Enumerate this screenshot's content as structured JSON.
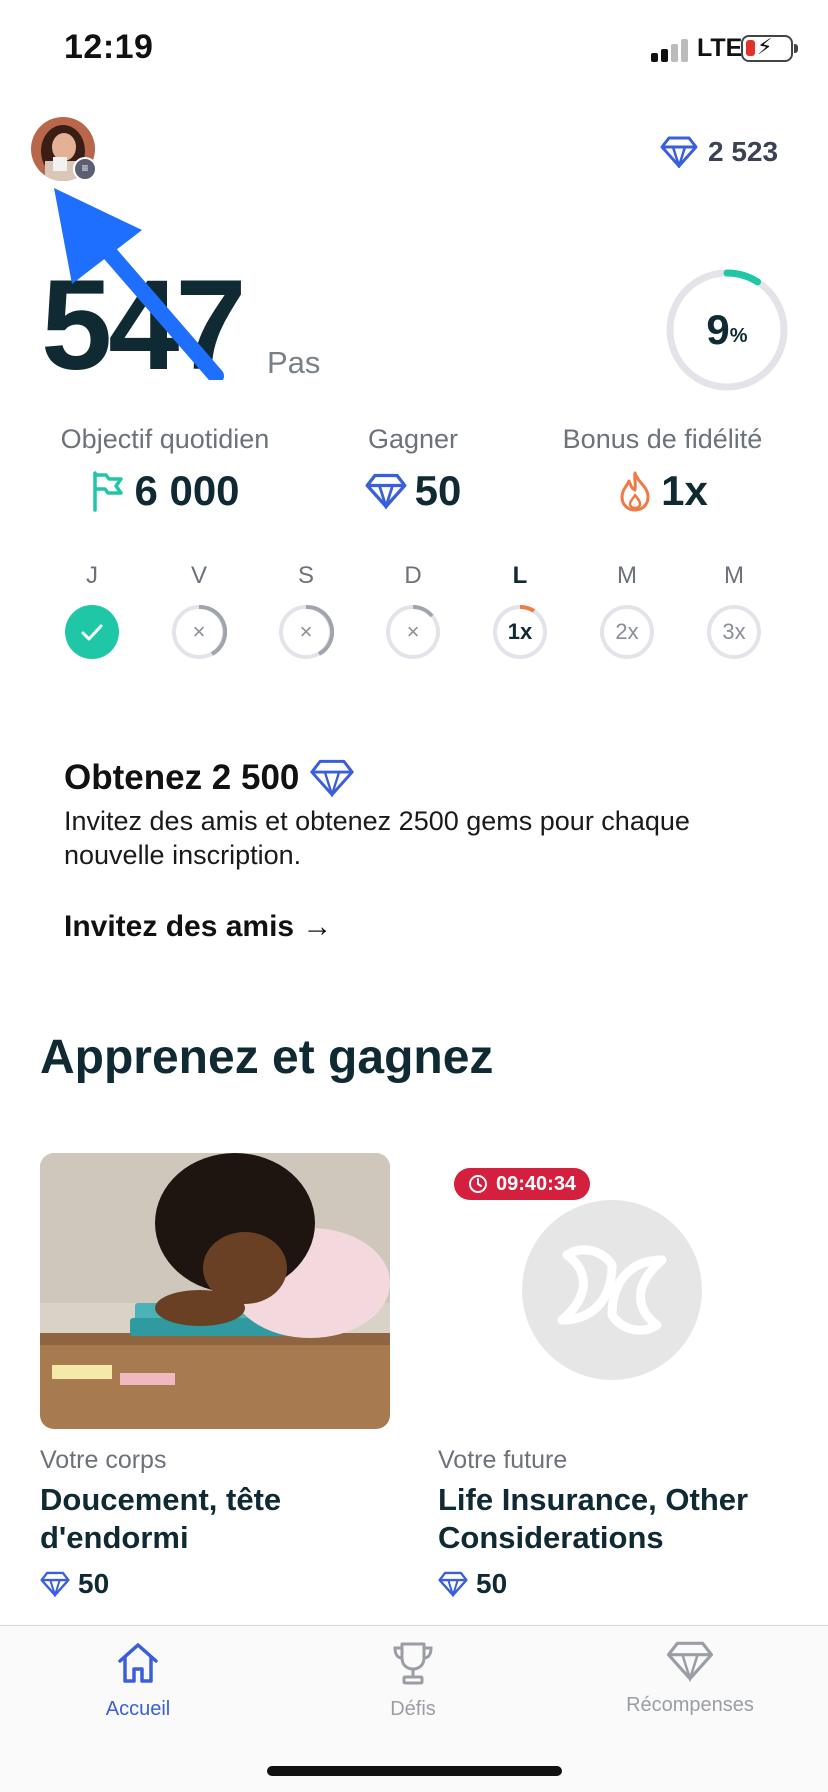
{
  "status_bar": {
    "time": "12:19",
    "network": "LTE"
  },
  "header": {
    "gems_total": "2 523",
    "avatar_icon": "avatar-photo",
    "gem_icon": "diamond-icon"
  },
  "steps": {
    "count": "547",
    "unit": "Pas",
    "progress_value": "9",
    "progress_suffix": "%",
    "progress_fraction": 0.09
  },
  "stats": [
    {
      "label": "Objectif quotidien",
      "value": "6 000",
      "icon": "flag-icon"
    },
    {
      "label": "Gagner",
      "value": "50",
      "icon": "diamond-icon"
    },
    {
      "label": "Bonus de fidélité",
      "value": "1x",
      "icon": "flame-icon"
    }
  ],
  "week": [
    {
      "day": "J",
      "state": "done",
      "text": ""
    },
    {
      "day": "V",
      "state": "missed",
      "text": "×"
    },
    {
      "day": "S",
      "state": "missed",
      "text": "×"
    },
    {
      "day": "D",
      "state": "missed",
      "text": "×"
    },
    {
      "day": "L",
      "state": "today",
      "text": "1x"
    },
    {
      "day": "M",
      "state": "future",
      "text": "2x"
    },
    {
      "day": "M",
      "state": "future",
      "text": "3x"
    }
  ],
  "promo": {
    "title": "Obtenez 2 500",
    "description": "Invitez des amis et obtenez 2500 gems pour chaque nouvelle inscription.",
    "link": "Invitez des amis →"
  },
  "learn": {
    "title": "Apprenez et gagnez",
    "cards": [
      {
        "category": "Votre corps",
        "title": "Doucement, tête d'endormi",
        "gems": "50"
      },
      {
        "category": "Votre future",
        "title": "Life Insurance, Other Considerations",
        "gems": "50",
        "timer": "09:40:34"
      }
    ]
  },
  "tabbar": {
    "tabs": [
      {
        "label": "Accueil",
        "icon": "home-icon",
        "active": true
      },
      {
        "label": "Défis",
        "icon": "trophy-icon",
        "active": false
      },
      {
        "label": "Récompenses",
        "icon": "diamond-icon",
        "active": false
      }
    ]
  },
  "colors": {
    "accent": "#3a5fd9",
    "teal": "#1fc7a6",
    "flame": "#f07a45",
    "timer": "#d41f3f",
    "arrow": "#1f6fff"
  }
}
